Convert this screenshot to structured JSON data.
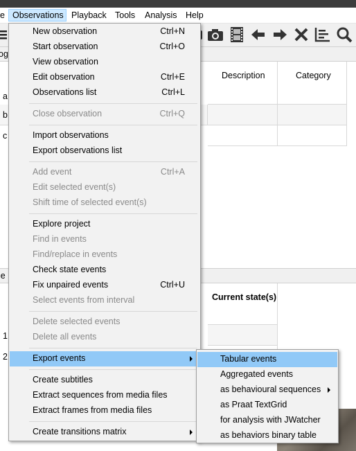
{
  "menubar": {
    "items": [
      {
        "label": "e"
      },
      {
        "label": "Observations"
      },
      {
        "label": "Playback"
      },
      {
        "label": "Tools"
      },
      {
        "label": "Analysis"
      },
      {
        "label": "Help"
      }
    ]
  },
  "top_table": {
    "headers": [
      "Description",
      "Category"
    ],
    "row_prefixes": [
      "a",
      "b",
      "c"
    ],
    "section_prefix": "og"
  },
  "bottom_table": {
    "section_prefix": "je",
    "headers": [
      "Current state(s)"
    ],
    "row_prefixes": [
      "1",
      "2"
    ]
  },
  "observations_menu": {
    "items": [
      {
        "label": "New observation",
        "shortcut": "Ctrl+N",
        "enabled": true
      },
      {
        "label": "Start observation",
        "shortcut": "Ctrl+O",
        "enabled": true
      },
      {
        "label": "View observation",
        "shortcut": "",
        "enabled": true
      },
      {
        "label": "Edit observation",
        "shortcut": "Ctrl+E",
        "enabled": true
      },
      {
        "label": "Observations list",
        "shortcut": "Ctrl+L",
        "enabled": true
      },
      {
        "label": "Close observation",
        "shortcut": "Ctrl+Q",
        "enabled": false
      },
      {
        "label": "Import observations",
        "shortcut": "",
        "enabled": true
      },
      {
        "label": "Export observations list",
        "shortcut": "",
        "enabled": true
      },
      {
        "label": "Add event",
        "shortcut": "Ctrl+A",
        "enabled": false
      },
      {
        "label": "Edit selected event(s)",
        "shortcut": "",
        "enabled": false
      },
      {
        "label": "Shift time of selected event(s)",
        "shortcut": "",
        "enabled": false
      },
      {
        "label": "Explore project",
        "shortcut": "",
        "enabled": true
      },
      {
        "label": "Find in events",
        "shortcut": "",
        "enabled": false
      },
      {
        "label": "Find/replace in events",
        "shortcut": "",
        "enabled": false
      },
      {
        "label": "Check state events",
        "shortcut": "",
        "enabled": true
      },
      {
        "label": "Fix unpaired events",
        "shortcut": "Ctrl+U",
        "enabled": true
      },
      {
        "label": "Select events from interval",
        "shortcut": "",
        "enabled": false
      },
      {
        "label": "Delete selected events",
        "shortcut": "",
        "enabled": false
      },
      {
        "label": "Delete all events",
        "shortcut": "",
        "enabled": false
      },
      {
        "label": "Export events",
        "shortcut": "",
        "enabled": true,
        "submenu": true,
        "highlighted": true
      },
      {
        "label": "Create subtitles",
        "shortcut": "",
        "enabled": true
      },
      {
        "label": "Extract sequences from media files",
        "shortcut": "",
        "enabled": true
      },
      {
        "label": "Extract frames from media files",
        "shortcut": "",
        "enabled": true
      },
      {
        "label": "Create transitions matrix",
        "shortcut": "",
        "enabled": true,
        "submenu": true
      }
    ]
  },
  "export_submenu": {
    "items": [
      {
        "label": "Tabular events",
        "highlighted": true
      },
      {
        "label": "Aggregated events"
      },
      {
        "label": "as behavioural sequences",
        "submenu": true
      },
      {
        "label": "as Praat TextGrid"
      },
      {
        "label": "for analysis with JWatcher"
      },
      {
        "label": "as behaviors binary table"
      }
    ]
  },
  "toolbar": {
    "icons": [
      "camera-icon",
      "film-icon",
      "arrow-left-icon",
      "arrow-right-icon",
      "close-icon",
      "chart-icon",
      "search-icon"
    ]
  },
  "colors": {
    "menu_highlight": "#91c9f7",
    "menubar_active": "#cce8ff",
    "disabled_text": "#8a8a8a"
  }
}
